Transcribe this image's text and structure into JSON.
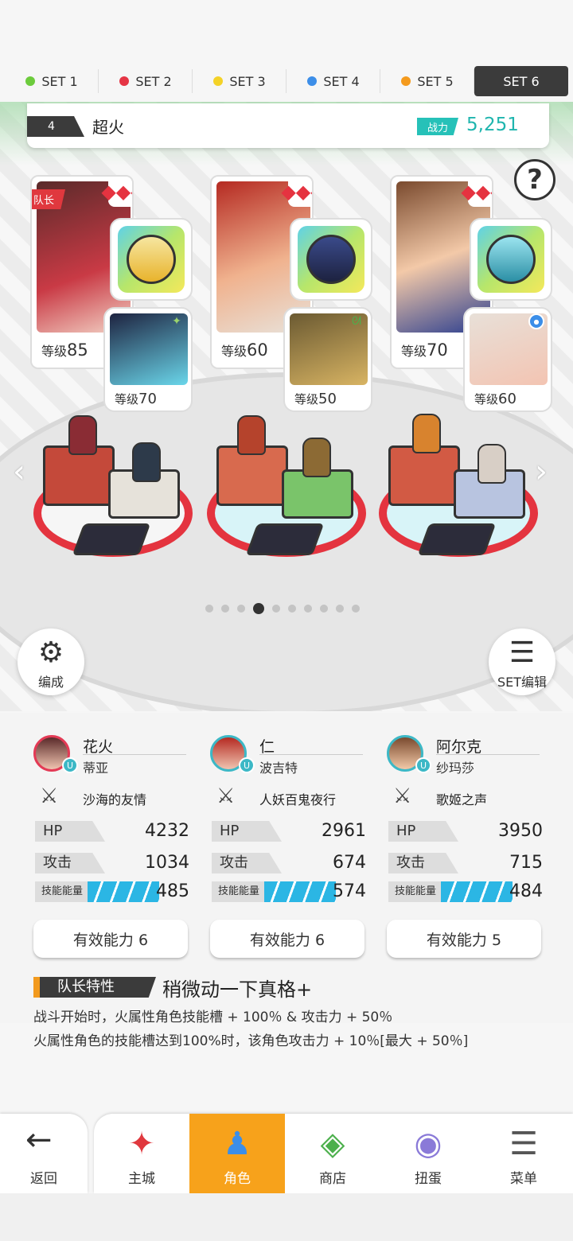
{
  "tabs": [
    {
      "label": "SET 1",
      "color": "#6ccb3c"
    },
    {
      "label": "SET 2",
      "color": "#e53545"
    },
    {
      "label": "SET 3",
      "color": "#f4d227"
    },
    {
      "label": "SET 4",
      "color": "#3c8ee8"
    },
    {
      "label": "SET 5",
      "color": "#f49a1d"
    },
    {
      "label": "SET 6",
      "active": true
    }
  ],
  "team": {
    "number": "4",
    "name": "超火",
    "power_label": "战力",
    "power_value": "5,251"
  },
  "help_label": "?",
  "slots": [
    {
      "leader_label": "队长",
      "main_level_prefix": "等级",
      "main_level": "85",
      "sub_level_prefix": "等级",
      "sub_level": "70",
      "suit": "◆◆◆",
      "sub_badge": "✦"
    },
    {
      "main_level_prefix": "等级",
      "main_level": "60",
      "sub_level_prefix": "等级",
      "sub_level": "50",
      "suit": "◆◆◆",
      "sub_badge": "ᘛ"
    },
    {
      "main_level_prefix": "等级",
      "main_level": "70",
      "sub_level_prefix": "等级",
      "sub_level": "60",
      "suit": "◆◆◆",
      "sub_badge": "●"
    }
  ],
  "pager": {
    "count": 10,
    "active": 3
  },
  "buttons": {
    "formation": "编成",
    "set_edit": "SET编辑"
  },
  "characters": [
    {
      "name": "花火",
      "sub": "蒂亚",
      "weapon": "沙海的友情",
      "hp_label": "HP",
      "hp": "4232",
      "atk_label": "攻击",
      "atk": "1034",
      "energy_label": "技能能量",
      "energy": "485",
      "effect": "有效能力 6"
    },
    {
      "name": "仁",
      "sub": "波吉特",
      "weapon": "人妖百鬼夜行",
      "hp_label": "HP",
      "hp": "2961",
      "atk_label": "攻击",
      "atk": "674",
      "energy_label": "技能能量",
      "energy": "574",
      "effect": "有效能力 6"
    },
    {
      "name": "阿尔克",
      "sub": "纱玛莎",
      "weapon": "歌姬之声",
      "hp_label": "HP",
      "hp": "3950",
      "atk_label": "攻击",
      "atk": "715",
      "energy_label": "技能能量",
      "energy": "484",
      "effect": "有效能力 5"
    }
  ],
  "leader_skill": {
    "tag": "队长特性",
    "name": "稍微动一下真格+",
    "line1": "战斗开始时，火属性角色技能槽 + 100％ & 攻击力 + 50％",
    "line2": "火属性角色的技能槽达到100%时，该角色攻击力 + 10％[最大 + 50％]"
  },
  "nav": {
    "back": "返回",
    "items": [
      "主城",
      "角色",
      "商店",
      "扭蛋",
      "菜单"
    ],
    "active_index": 1
  }
}
